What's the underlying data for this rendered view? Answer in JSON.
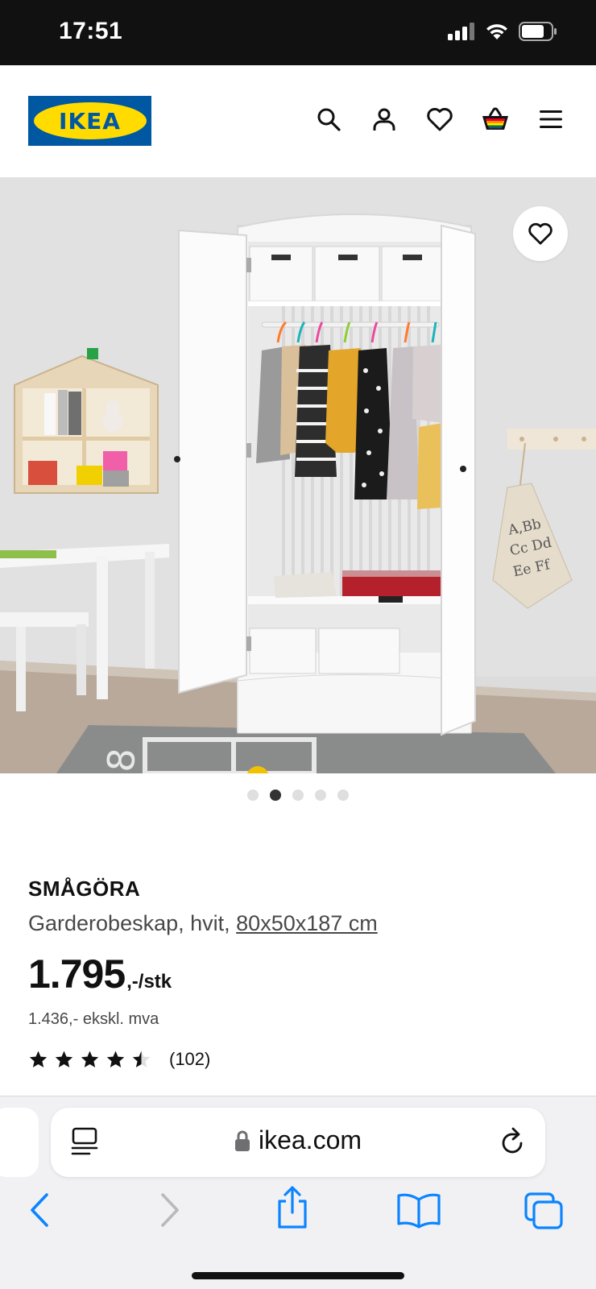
{
  "status_bar": {
    "time": "17:51"
  },
  "header": {
    "logo_text": "IKEA"
  },
  "gallery": {
    "total_images": 5,
    "active_index": 1
  },
  "product": {
    "name": "SMÅGÖRA",
    "description": "Garderobeskap, hvit,",
    "dimensions": "80x50x187 cm",
    "price": "1.795",
    "price_suffix": ",-/stk",
    "price_ex_vat": "1.436,- ekskl. mva",
    "rating_value": 4.5,
    "rating_count": "(102)"
  },
  "browser": {
    "url": "ikea.com"
  },
  "colors": {
    "ikea_blue": "#0058a3",
    "ikea_yellow": "#ffdb00",
    "ios_blue": "#0a84ff"
  },
  "icons": [
    "search-icon",
    "account-icon",
    "wishlist-icon",
    "cart-icon",
    "menu-icon",
    "heart-icon",
    "star-icon",
    "lock-icon",
    "reload-icon",
    "reader-icon",
    "back-icon",
    "forward-icon",
    "share-icon",
    "bookmarks-icon",
    "tabs-icon"
  ]
}
